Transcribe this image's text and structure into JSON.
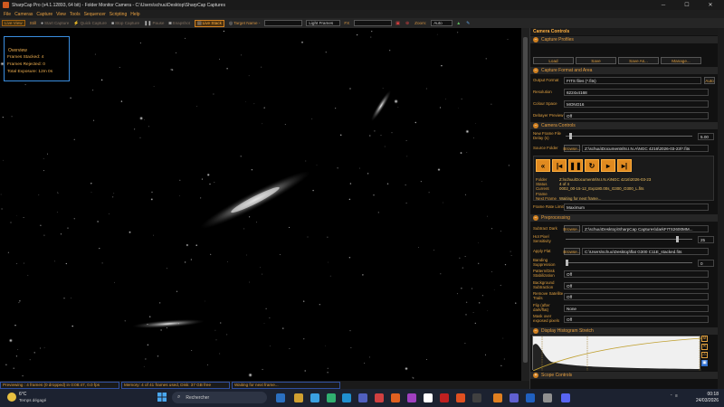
{
  "window": {
    "title": "SharpCap Pro (v4.1.12893, 64 bit) - Folder Monitor Camera - C:\\Users\\schuu\\Desktop\\SharpCap Captures",
    "min": "─",
    "max": "☐",
    "close": "✕"
  },
  "menu": [
    "File",
    "Cameras",
    "Capture",
    "View",
    "Tools",
    "Sequencer",
    "Scripting",
    "Help"
  ],
  "toolbar": {
    "live_view": "Live View",
    "still": "Still",
    "start_capture": "Start Capture",
    "quick_capture": "Quick Capture",
    "stop_capture": "Stop Capture",
    "pause": "Pause",
    "snapshot": "Snapshot",
    "live_stack": "Live Stack",
    "target_name_label": "Target Name -",
    "target_name_value": "",
    "frame_type": "Light Frames",
    "fx_label": "FX",
    "fx_value": "",
    "zoom_label": "Zoom:",
    "zoom_value": "Auto"
  },
  "overview": {
    "title": "Overview",
    "frames_stacked": "Frames Stacked:  4",
    "frames_rejected": "Frames Rejected:  0",
    "total_exposure": "Total Exposure:     12m 0s"
  },
  "status": {
    "previewing": "Previewing : 4 frames (0 dropped) in 0:08:47, 0.0 fps",
    "memory": "Memory: 4 of 41 frames used, Disk: 37 GB free",
    "waiting": "Waiting for next frame..."
  },
  "panel": {
    "title": "Camera Controls",
    "capture_profiles": {
      "header": "Capture Profiles",
      "load": "Load",
      "save": "Save",
      "save_as": "Save As...",
      "manage": "Manage..."
    },
    "capture_format": {
      "header": "Capture Format and Area",
      "output_format_label": "Output Format",
      "output_format_value": "FITS files (*.fits)",
      "auto": "Auto",
      "resolution_label": "Resolution",
      "resolution_value": "6224x4168",
      "colour_space_label": "Colour Space",
      "colour_space_value": "MONO16",
      "debayer_label": "Debayer Preview",
      "debayer_value": "Off"
    },
    "camera_controls": {
      "header": "Camera Controls",
      "new_frame_label": "New Frame File Delay (s)",
      "new_frame_value": "5.00",
      "source_folder_label": "Source Folder",
      "browse": "Browse...",
      "source_folder_value": "Z:\\schuu\\Documents\\N.I.N.A\\NGC 4216\\2026-03-23\\*.fits",
      "folder_label": "Folder",
      "folder_value": "Z:\\schuu\\Documents\\N.I.N.A\\NGC 4216\\2026-03-23",
      "status_label": "Status",
      "status_value": "4 of 4",
      "current_frame_label": "Current Frame",
      "current_frame_value": "0002_00-15-12_Exp180.00s_G300_O300_L.fits",
      "next_frame_label": "Next Frame",
      "next_frame_value": "Waiting for next frame...",
      "frame_rate_label": "Frame Rate Limit",
      "frame_rate_value": "Maximum"
    },
    "preprocessing": {
      "header": "Preprocessing",
      "subtract_dark_label": "Subtract Dark",
      "subtract_dark_value": "Z:\\schuu\\Desktop\\SharpCap Captures\\darkFITS2600MM...",
      "hot_pixel_label": "Hot Pixel Sensitivity",
      "hot_pixel_value": "25",
      "apply_flat_label": "Apply Flat",
      "apply_flat_value": "C:\\Users\\schuu\\Desktop\\flat G300 C11E_stacked.fits",
      "banding_label": "Banding Suppression",
      "banding_value": "0",
      "pattern_label": "Pattern/Disk Stabilization",
      "pattern_value": "Off",
      "background_label": "Background Subtraction",
      "background_value": "Off",
      "satellite_label": "Remove Satellite Trails",
      "satellite_value": "Off",
      "flip_label": "Flip (after dark/flat)",
      "flip_value": "None",
      "mask_label": "Mask over exposed pixels",
      "mask_value": "Off"
    },
    "histogram": {
      "header": "Display Histogram Stretch"
    },
    "scope": {
      "header": "Scope Controls"
    }
  },
  "taskbar": {
    "temperature": "6°C",
    "weather": "Temps dégagé",
    "search": "Rechercher",
    "time": "00:18",
    "date": "24/03/2026"
  }
}
